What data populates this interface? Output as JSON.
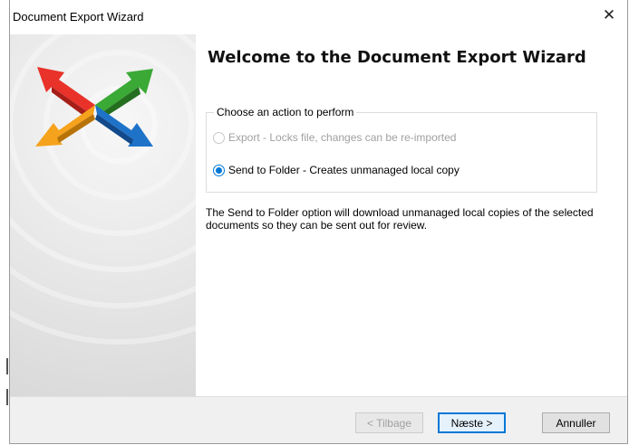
{
  "window": {
    "title": "Document Export Wizard",
    "close_glyph": "✕"
  },
  "main": {
    "heading": "Welcome to the Document Export Wizard",
    "group": {
      "legend": "Choose an action to perform",
      "options": [
        {
          "label": "Export - Locks file, changes can be re-imported",
          "selected": false,
          "enabled": false
        },
        {
          "label": "Send to Folder - Creates unmanaged local copy",
          "selected": true,
          "enabled": true
        }
      ]
    },
    "description": "The Send to Folder option will download unmanaged local copies of the selected documents so they can be sent out for review."
  },
  "footer": {
    "back_label": "< Tilbage",
    "next_label": "Næste >",
    "cancel_label": "Annuller"
  },
  "colors": {
    "accent": "#0078d7",
    "logo_arrows": [
      "#e8322a",
      "#f5a21c",
      "#3aa935",
      "#1e73c9"
    ]
  },
  "icons": {
    "logo": "four-direction-arrows-icon",
    "close": "close-icon"
  }
}
